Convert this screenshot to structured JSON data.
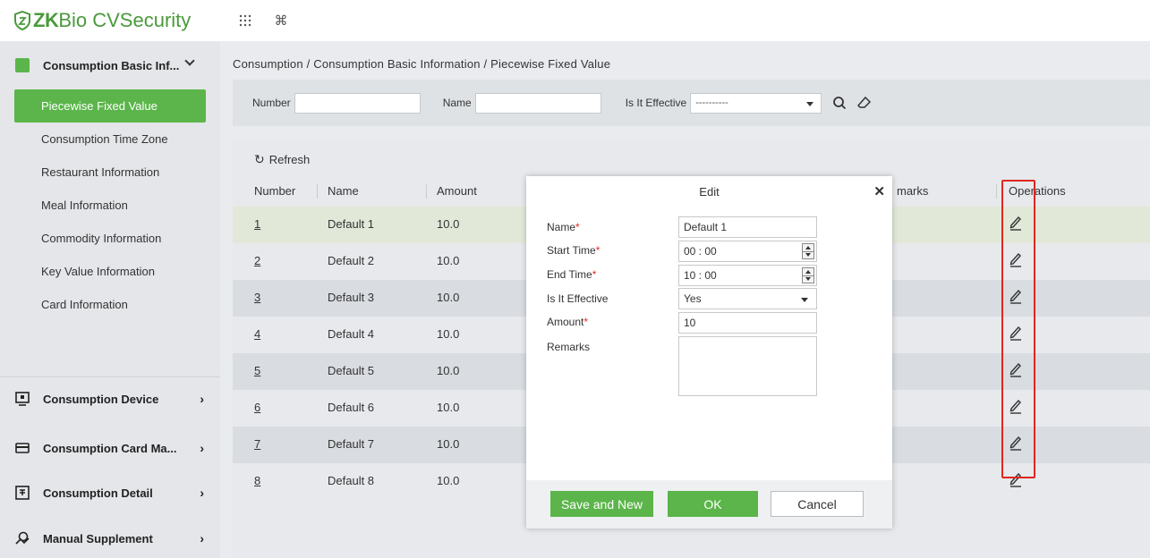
{
  "app": {
    "brand_prefix": "ZK",
    "brand_rest": "Bio CVSecurity",
    "accent_color": "#5bb54a",
    "icons": [
      "apps-grid-icon",
      "command-icon"
    ]
  },
  "sidebar": {
    "group_basic": "Consumption Basic Inf...",
    "items": [
      {
        "label": "Piecewise Fixed Value",
        "active": true
      },
      {
        "label": "Consumption Time Zone"
      },
      {
        "label": "Restaurant Information"
      },
      {
        "label": "Meal Information"
      },
      {
        "label": "Commodity Information"
      },
      {
        "label": "Key Value Information"
      },
      {
        "label": "Card Information"
      }
    ],
    "groups": [
      {
        "label": "Consumption Device",
        "icon": "monitor-icon"
      },
      {
        "label": "Consumption Card Ma...",
        "icon": "card-icon"
      },
      {
        "label": "Consumption Detail",
        "icon": "detail-icon"
      },
      {
        "label": "Manual Supplement",
        "icon": "supplement-icon"
      }
    ]
  },
  "breadcrumb": "Consumption / Consumption Basic Information / Piecewise Fixed Value",
  "filters": {
    "number_label": "Number",
    "name_label": "Name",
    "effective_label": "Is It Effective",
    "effective_value": "----------"
  },
  "toolbar": {
    "refresh": "Refresh"
  },
  "table": {
    "headers": {
      "number": "Number",
      "name": "Name",
      "amount": "Amount",
      "remarks": "marks",
      "operations": "Operations"
    },
    "rows": [
      {
        "number": "1",
        "name": "Default 1",
        "amount": "10.0"
      },
      {
        "number": "2",
        "name": "Default 2",
        "amount": "10.0"
      },
      {
        "number": "3",
        "name": "Default 3",
        "amount": "10.0"
      },
      {
        "number": "4",
        "name": "Default 4",
        "amount": "10.0"
      },
      {
        "number": "5",
        "name": "Default 5",
        "amount": "10.0"
      },
      {
        "number": "6",
        "name": "Default 6",
        "amount": "10.0"
      },
      {
        "number": "7",
        "name": "Default 7",
        "amount": "10.0"
      },
      {
        "number": "8",
        "name": "Default 8",
        "amount": "10.0"
      }
    ]
  },
  "modal": {
    "title": "Edit",
    "fields": {
      "name_label": "Name",
      "name_value": "Default 1",
      "start_label": "Start Time",
      "start_value": "00 : 00",
      "end_label": "End Time",
      "end_value": "10 : 00",
      "effective_label": "Is It Effective",
      "effective_value": "Yes",
      "amount_label": "Amount",
      "amount_value": "10",
      "remarks_label": "Remarks"
    },
    "buttons": {
      "save_new": "Save and New",
      "ok": "OK",
      "cancel": "Cancel"
    }
  }
}
